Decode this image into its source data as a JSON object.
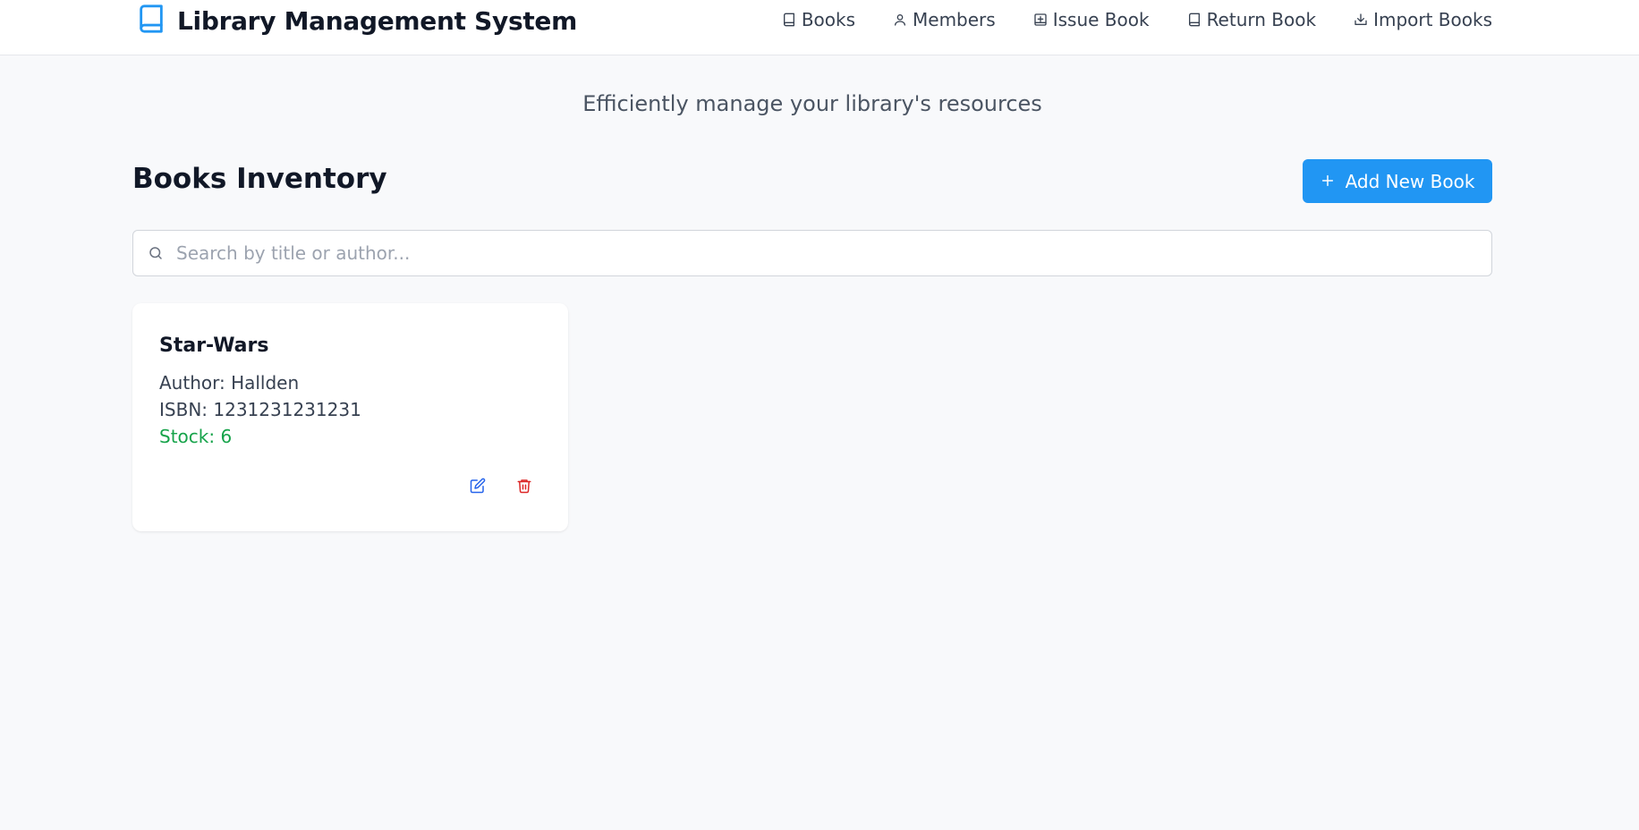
{
  "header": {
    "title": "Library Management System",
    "logo_icon": "book-icon",
    "nav": [
      {
        "label": "Books",
        "icon": "book-icon"
      },
      {
        "label": "Members",
        "icon": "user-icon"
      },
      {
        "label": "Issue Book",
        "icon": "book-plus-icon"
      },
      {
        "label": "Return Book",
        "icon": "book-icon"
      },
      {
        "label": "Import Books",
        "icon": "import-icon"
      }
    ]
  },
  "main": {
    "tagline": "Efficiently manage your library's resources",
    "section_title": "Books Inventory",
    "add_button_label": "Add New Book",
    "search": {
      "placeholder": "Search by title or author...",
      "value": ""
    },
    "books": [
      {
        "title": "Star-Wars",
        "author": "Author: Hallden",
        "isbn": "ISBN: 1231231231231",
        "stock": "Stock: 6"
      }
    ]
  },
  "colors": {
    "accent": "#2196f3",
    "stock_ok": "#16a34a",
    "edit": "#2563eb",
    "delete": "#dc2626",
    "background": "#f8f9fb"
  }
}
